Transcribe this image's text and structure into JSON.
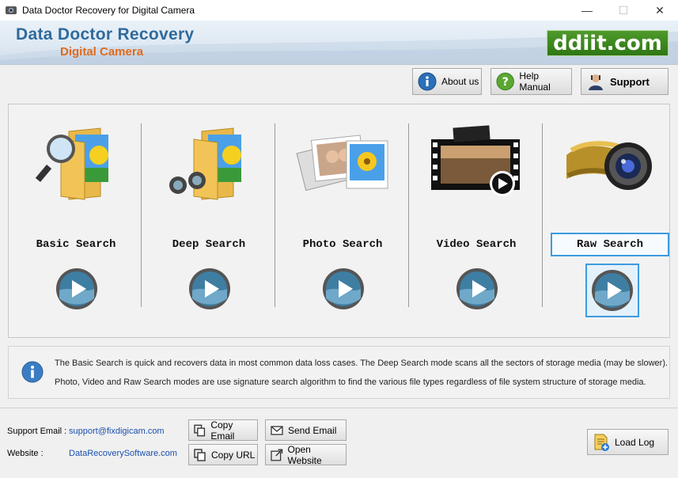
{
  "window": {
    "title": "Data Doctor Recovery for Digital Camera",
    "controls": {
      "minimize": "—",
      "maximize": "☐",
      "close": "✕"
    }
  },
  "banner": {
    "title": "Data Doctor Recovery",
    "subtitle": "Digital Camera",
    "site_logo": "ddiit.com"
  },
  "toolbar": {
    "about": "About us",
    "help": "Help Manual",
    "support": "Support"
  },
  "search_modes": [
    {
      "label": "Basic Search",
      "icon": "folder-magnifier-icon"
    },
    {
      "label": "Deep Search",
      "icon": "folder-binoculars-icon"
    },
    {
      "label": "Photo Search",
      "icon": "photos-icon"
    },
    {
      "label": "Video Search",
      "icon": "film-strip-icon"
    },
    {
      "label": "Raw Search",
      "icon": "camera-lens-icon"
    }
  ],
  "selected_mode": "Raw Search",
  "info": {
    "line1": "The Basic Search is quick and recovers data in most common data loss cases. The Deep Search mode scans all the sectors of storage media (may be slower).",
    "line2": "Photo, Video and Raw Search modes are use signature search algorithm to find the various file types regardless of file system structure of storage media."
  },
  "footer": {
    "support_email_label": "Support Email :",
    "support_email": "support@fixdigicam.com",
    "website_label": "Website :",
    "website": "DataRecoverySoftware.com",
    "copy_email": "Copy Email",
    "send_email": "Send Email",
    "copy_url": "Copy URL",
    "open_website": "Open Website",
    "load_log": "Load Log"
  },
  "colors": {
    "accent_blue": "#3d9be0",
    "brand_blue": "#2f6a9d",
    "brand_orange": "#e06a1a",
    "logo_green": "#3a8a1e",
    "link_blue": "#1a4fb0"
  }
}
